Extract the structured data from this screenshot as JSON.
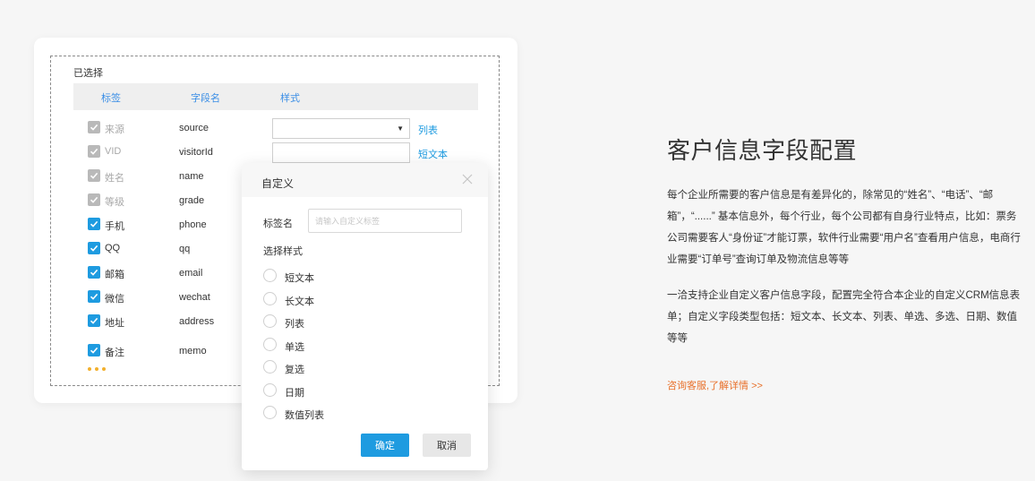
{
  "panel": {
    "selected_title": "已选择",
    "headers": {
      "label": "标签",
      "field": "字段名",
      "style": "样式"
    },
    "rows": [
      {
        "label": "来源",
        "field": "source",
        "checked_state": "locked",
        "style_control": "select",
        "style_link": "列表"
      },
      {
        "label": "VID",
        "field": "visitorId",
        "checked_state": "locked",
        "style_control": "input",
        "style_link": "短文本"
      },
      {
        "label": "姓名",
        "field": "name",
        "checked_state": "locked"
      },
      {
        "label": "等级",
        "field": "grade",
        "checked_state": "locked"
      },
      {
        "label": "手机",
        "field": "phone",
        "checked_state": "checked"
      },
      {
        "label": "QQ",
        "field": "qq",
        "checked_state": "checked"
      },
      {
        "label": "邮箱",
        "field": "email",
        "checked_state": "checked"
      },
      {
        "label": "微信",
        "field": "wechat",
        "checked_state": "checked"
      },
      {
        "label": "地址",
        "field": "address",
        "checked_state": "checked"
      },
      {
        "label": "备注",
        "field": "memo",
        "checked_state": "checked"
      }
    ]
  },
  "modal": {
    "title": "自定义",
    "name_label": "标签名",
    "name_placeholder": "请输入自定义标签",
    "style_label": "选择样式",
    "options": [
      "短文本",
      "长文本",
      "列表",
      "单选",
      "复选",
      "日期",
      "数值列表"
    ],
    "ok_label": "确定",
    "cancel_label": "取消"
  },
  "info": {
    "title": "客户信息字段配置",
    "paragraph1": "每个企业所需要的客户信息是有差异化的，除常见的“姓名”、“电话”、“邮箱”，“......” 基本信息外，每个行业，每个公司都有自身行业特点，比如：票务公司需要客人“身份证”才能订票，软件行业需要“用户名”查看用户信息，电商行业需要“订单号”查询订单及物流信息等等",
    "paragraph2": "一洽支持企业自定义客户信息字段，配置完全符合本企业的自定义CRM信息表单；自定义字段类型包括：短文本、长文本、列表、单选、多选、日期、数值等等",
    "consult_link": "咨询客服,了解详情 >>"
  },
  "colors": {
    "accent": "#1e9be0",
    "locked_checkbox": "#b9b9b9",
    "link_orange": "#e8702a",
    "loading_dots": "#f2b02d"
  }
}
